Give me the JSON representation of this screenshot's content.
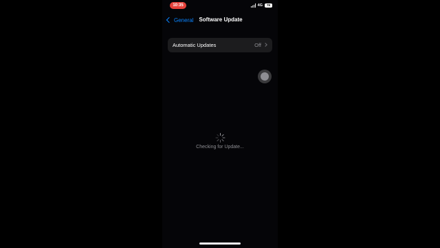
{
  "status_bar": {
    "time": "10:35",
    "network": "4G",
    "battery": "76"
  },
  "nav": {
    "back_label": "General",
    "title": "Software Update"
  },
  "settings": {
    "automatic_updates_label": "Automatic Updates",
    "automatic_updates_value": "Off"
  },
  "status": {
    "text": "Checking for Update..."
  },
  "colors": {
    "accent": "#0a84ff",
    "time_pill": "#e6413a",
    "row_background": "#1c1c1e",
    "secondary_text": "#8e8e93"
  },
  "icons": {
    "back": "chevron-left-icon",
    "row": "chevron-right-icon",
    "loading": "spinner-icon",
    "signal": "signal-icon",
    "battery": "battery-icon"
  }
}
